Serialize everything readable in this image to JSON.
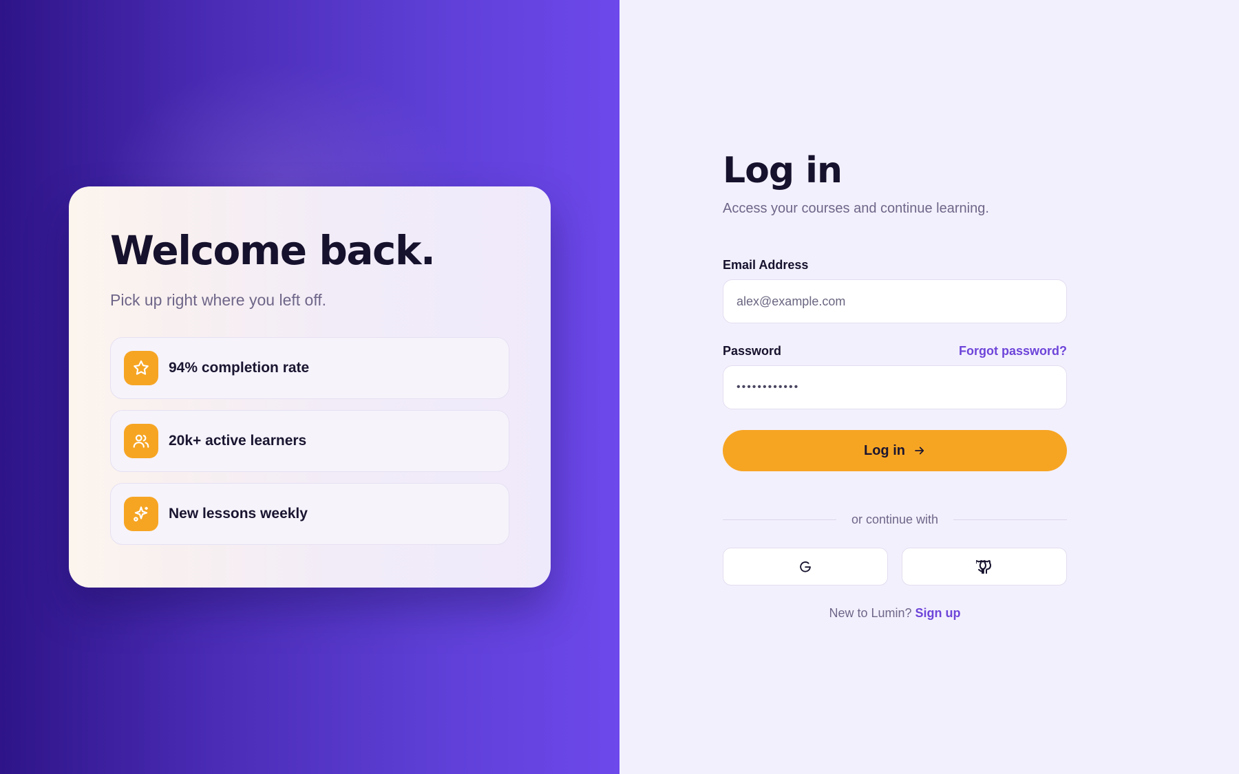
{
  "hero": {
    "title": "Welcome back.",
    "subtitle": "Pick up right where you left off.",
    "features": [
      {
        "icon": "star-icon",
        "label": "94% completion rate"
      },
      {
        "icon": "users-icon",
        "label": "20k+ active learners"
      },
      {
        "icon": "sparkles-icon",
        "label": "New lessons weekly"
      }
    ]
  },
  "form": {
    "title": "Log in",
    "subtitle": "Access your courses and continue learning.",
    "email_label": "Email Address",
    "email_placeholder": "alex@example.com",
    "password_label": "Password",
    "forgot_label": "Forgot password?",
    "password_masked": "••••••••••••",
    "login_label": "Log in",
    "divider_text": "or continue with",
    "socials": [
      {
        "icon": "google-icon"
      },
      {
        "icon": "github-icon"
      }
    ],
    "signup_prompt": "New to Lumin?",
    "signup_label": "Sign up"
  },
  "colors": {
    "accent": "#f6a523",
    "brand": "#6d45d9",
    "ink": "#16112c"
  }
}
